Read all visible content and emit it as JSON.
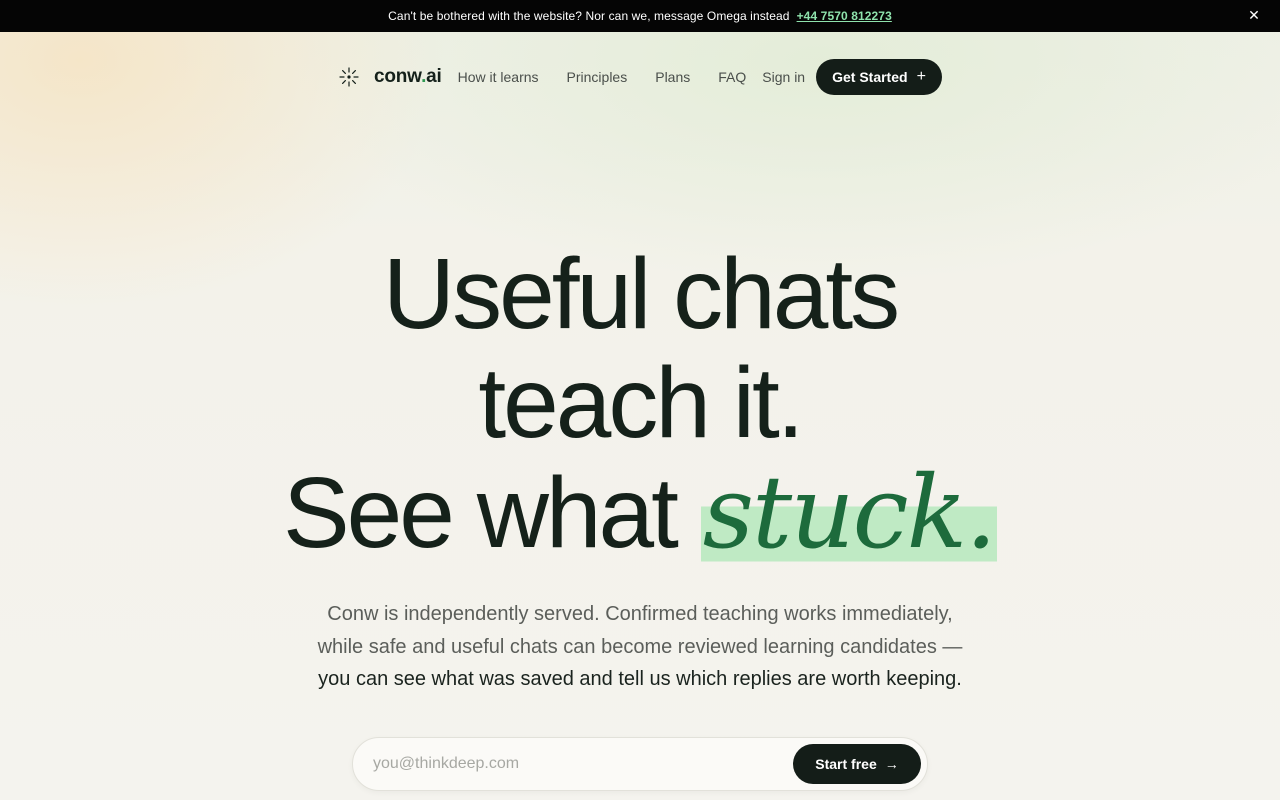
{
  "announcement": {
    "message": "Can't be bothered with the website? Nor can we, message Omega instead",
    "phone": "+44 7570 812273",
    "close_icon": "close-icon"
  },
  "nav": {
    "logo_icon": "sparkle-logo-icon",
    "brand_main": "conw",
    "brand_dot": ".",
    "brand_tail": "ai",
    "links": [
      "How it learns",
      "Principles",
      "Plans",
      "FAQ"
    ],
    "signin": "Sign in",
    "cta": "Get Started",
    "cta_icon": "plus-icon"
  },
  "hero": {
    "line1": "Useful chats",
    "line2": "teach it.",
    "line3_prefix": "See what ",
    "line3_highlight": "stuck.",
    "subtitle_line1": "Conw is independently served. Confirmed teaching works immediately,",
    "subtitle_line2": "while safe and useful chats can become reviewed learning candidates —",
    "subtitle_line3": "you can see what was saved and tell us which replies are worth keeping."
  },
  "signup": {
    "placeholder": "you@thinkdeep.com",
    "button": "Start free",
    "button_icon": "arrow-right-icon"
  },
  "colors": {
    "accent": "#1d6b3c",
    "highlight": "#bfeac4",
    "dark": "#141d18",
    "phone": "#8fe3ad"
  }
}
